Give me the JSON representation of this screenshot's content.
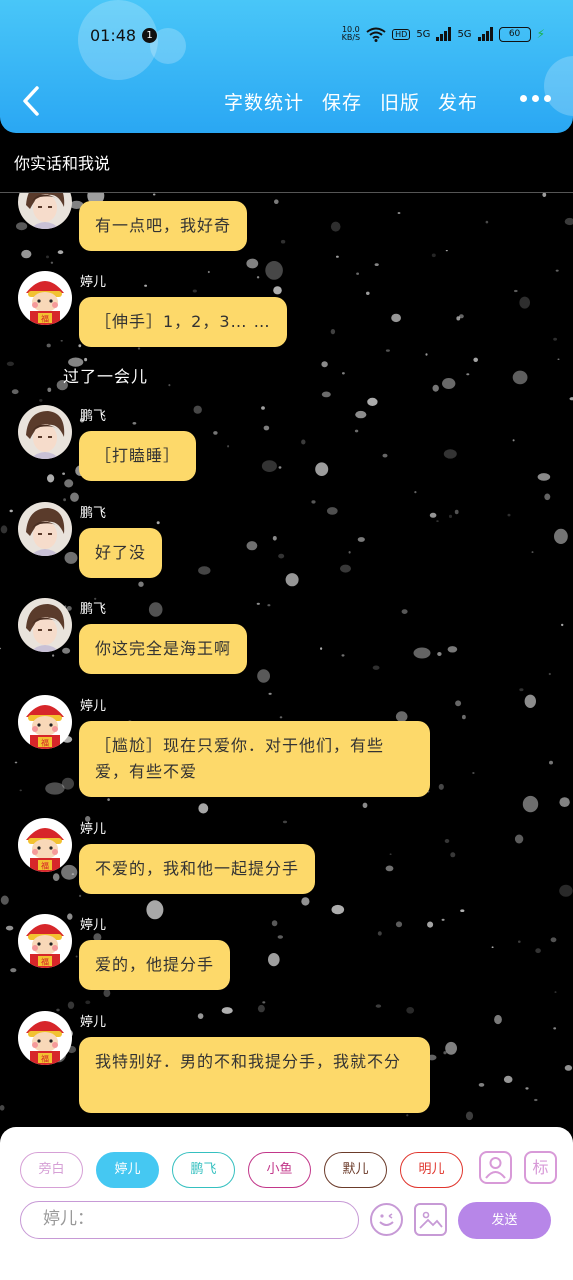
{
  "status_bar": {
    "time": "01:48",
    "notification_count": "1",
    "net_speed_value": "10.0",
    "net_speed_unit": "KB/S",
    "hd_label": "HD",
    "sim1_label": "5G",
    "sim2_label": "5G",
    "battery_level": "60"
  },
  "toolbar": {
    "word_count_label": "字数统计",
    "save_label": "保存",
    "old_version_label": "旧版",
    "publish_label": "发布"
  },
  "chat_title": "你实话和我说",
  "messages": [
    {
      "speaker": "",
      "text": "有一点吧，我好奇",
      "avatar": "boy"
    },
    {
      "speaker": "婷儿",
      "text": "［伸手］1，2，3… …",
      "avatar": "girl"
    },
    {
      "narration": "过了一会儿"
    },
    {
      "speaker": "鹏飞",
      "text": "［打瞌睡］",
      "avatar": "boy"
    },
    {
      "speaker": "鹏飞",
      "text": "好了没",
      "avatar": "boy"
    },
    {
      "speaker": "鹏飞",
      "text": "你这完全是海王啊",
      "avatar": "boy"
    },
    {
      "speaker": "婷儿",
      "text": "［尴尬］现在只爱你．对于他们，有些爱，有些不爱",
      "avatar": "girl"
    },
    {
      "speaker": "婷儿",
      "text": "不爱的，我和他一起提分手",
      "avatar": "girl"
    },
    {
      "speaker": "婷儿",
      "text": "爱的，他提分手",
      "avatar": "girl"
    },
    {
      "speaker": "婷儿",
      "text": "我特别好．男的不和我提分手，我就不分",
      "avatar": "girl"
    }
  ],
  "roles": [
    {
      "label": "旁白",
      "color": "#d6a0d6",
      "active": false
    },
    {
      "label": "婷儿",
      "color": "#45c8f2",
      "active": true
    },
    {
      "label": "鹏飞",
      "color": "#35c0c0",
      "active": false
    },
    {
      "label": "小鱼",
      "color": "#c2378a",
      "active": false
    },
    {
      "label": "默儿",
      "color": "#6b3b2a",
      "active": false
    },
    {
      "label": "明儿",
      "color": "#e0352d",
      "active": false
    }
  ],
  "role_icon_person": "person-icon",
  "role_icon_tag": "标",
  "input": {
    "placeholder": "婷儿："
  },
  "send_label": "发送",
  "colors": {
    "header": "#2aa7f3",
    "bubble": "#fdd96a",
    "send": "#b786e8"
  }
}
